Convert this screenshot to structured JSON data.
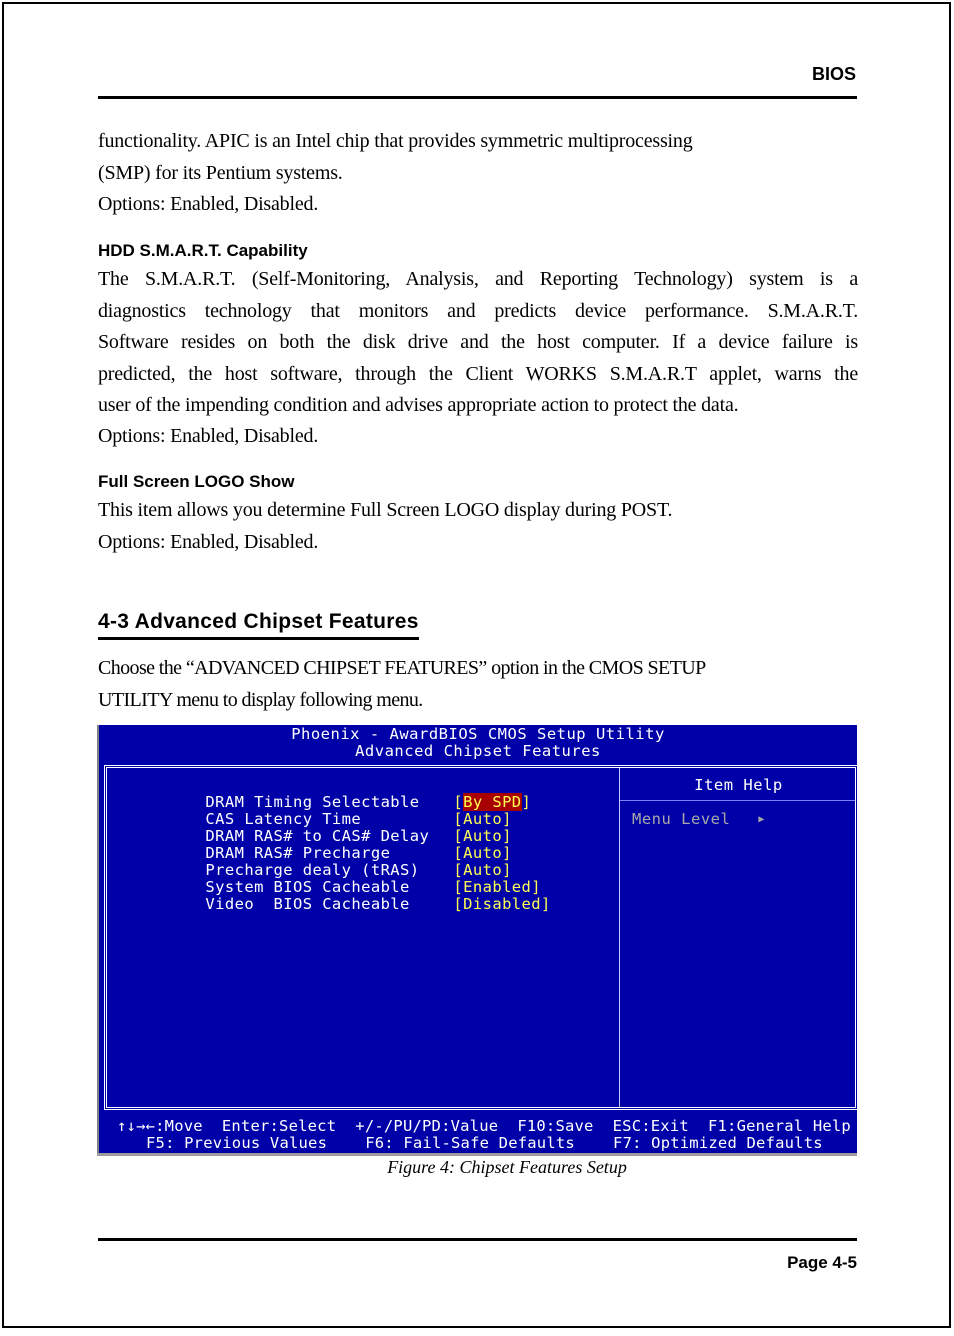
{
  "header": {
    "title": "BIOS"
  },
  "apic_continuation": {
    "lines": [
      "functionality. APIC is an Intel chip that provides symmetric multiprocessing",
      "(SMP) for its Pentium systems.",
      "Options: Enabled, Disabled."
    ]
  },
  "hdd_smart": {
    "heading": "HDD S.M.A.R.T. Capability",
    "lines": [
      "The S.M.A.R.T. (Self-Monitoring, Analysis, and Reporting Technology) system is a",
      "diagnostics technology that monitors and predicts device performance. S.M.A.R.T.",
      "Software resides on both the disk drive and the host computer.   If a device failure is",
      "predicted, the host software, through the Client WORKS S.M.A.R.T applet, warns the",
      "user of the impending condition and advises appropriate action to protect the data."
    ],
    "options": "Options: Enabled, Disabled."
  },
  "full_screen_logo": {
    "heading": "Full Screen LOGO Show",
    "lines": [
      "This item allows you determine Full Screen LOGO display during POST.",
      "Options: Enabled, Disabled."
    ]
  },
  "section": {
    "title": "4-3 Advanced Chipset Features",
    "intro_lines": [
      "Choose the “ADVANCED CHIPSET FEATURES” option  in the CMOS SETUP",
      "UTILITY menu to display following menu."
    ]
  },
  "bios": {
    "colors": {
      "background": "#0000a8",
      "label": "#ffffff",
      "value": "#ffff54",
      "selected_bg": "#a80000",
      "help_dim": "#a8a8a8"
    },
    "title_line1": "Phoenix - AwardBIOS CMOS Setup Utility",
    "title_line2": "Advanced Chipset Features",
    "settings": [
      {
        "label": "DRAM Timing Selectable",
        "value": "By SPD",
        "selected": true
      },
      {
        "label": "CAS Latency Time",
        "value": "Auto",
        "selected": false
      },
      {
        "label": "DRAM RAS# to CAS# Delay",
        "value": "Auto",
        "selected": false
      },
      {
        "label": "DRAM RAS# Precharge",
        "value": "Auto",
        "selected": false
      },
      {
        "label": "Precharge dealy (tRAS)",
        "value": "Auto",
        "selected": false
      },
      {
        "label": "System BIOS Cacheable",
        "value": "Enabled",
        "selected": false
      },
      {
        "label": "Video  BIOS Cacheable",
        "value": "Disabled",
        "selected": false
      }
    ],
    "item_help": "Item Help",
    "menu_level": "Menu Level",
    "menu_level_icon": "triangle-right",
    "keys_line1": "↑↓→←:Move  Enter:Select  +/-/PU/PD:Value  F10:Save  ESC:Exit  F1:General Help",
    "keys_line2": "F5: Previous Values    F6: Fail-Safe Defaults    F7: Optimized Defaults"
  },
  "figure_caption": "Figure 4:  Chipset Features Setup",
  "footer": {
    "page": "Page 4-5"
  }
}
